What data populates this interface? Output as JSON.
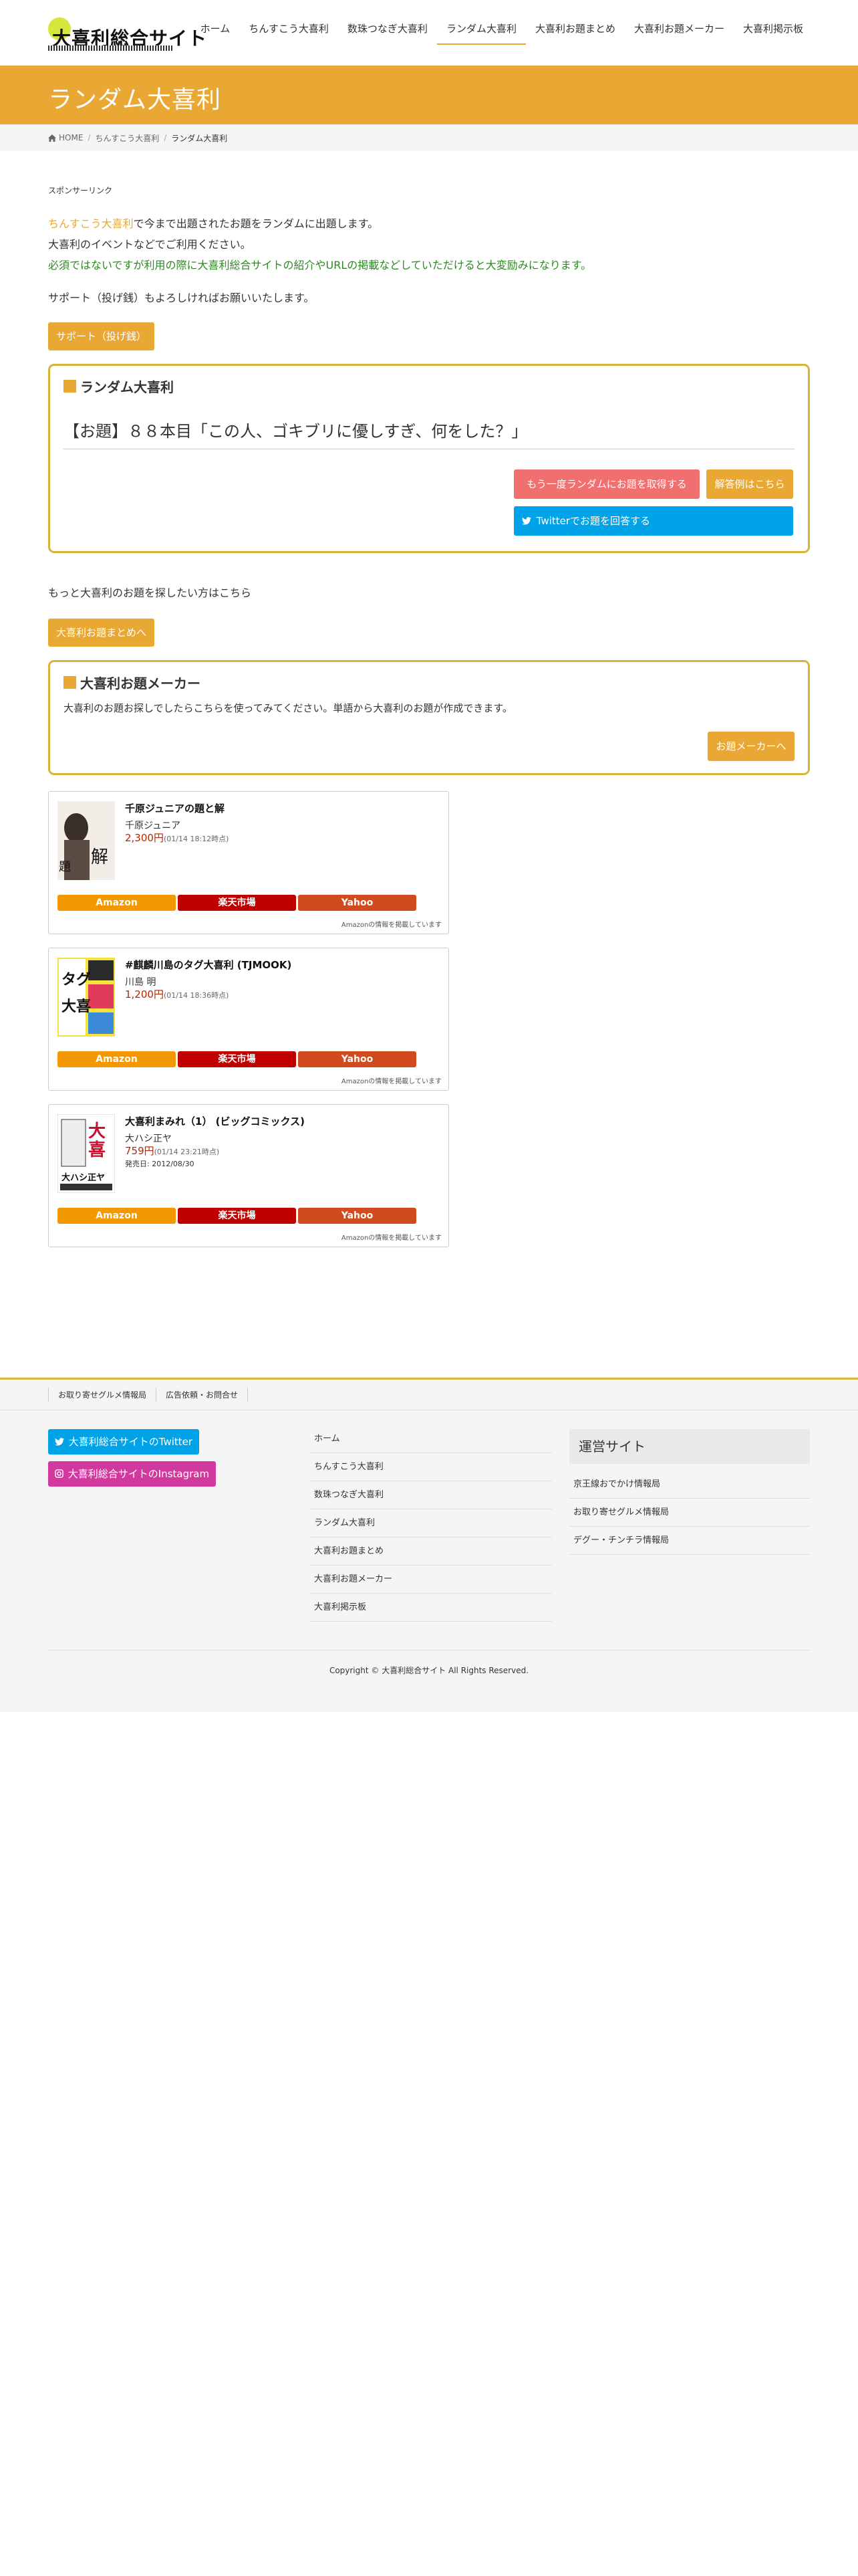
{
  "site": {
    "logo_text": "大喜利総合サイト",
    "nav": [
      "ホーム",
      "ちんすこう大喜利",
      "数珠つなぎ大喜利",
      "ランダム大喜利",
      "大喜利お題まとめ",
      "大喜利お題メーカー",
      "大喜利掲示板"
    ],
    "active_nav": "ランダム大喜利"
  },
  "page": {
    "title": "ランダム大喜利",
    "breadcrumb": {
      "home": "HOME",
      "parent": "ちんすこう大喜利",
      "current": "ランダム大喜利"
    }
  },
  "content": {
    "sponsor": "スポンサーリンク",
    "intro_link": "ちんすこう大喜利",
    "intro_line1_rest": "で今まで出題されたお題をランダムに出題します。",
    "intro_line2": "大喜利のイベントなどでご利用ください。",
    "intro_line3": "必須ではないですが利用の際に大喜利総合サイトの紹介やURLの掲載などしていただけると大変励みになります。",
    "support_text": "サポート（投げ銭）もよろしければお願いいたします。",
    "support_button": "サポート（投げ銭）"
  },
  "random_box": {
    "title": "ランダム大喜利",
    "odai": "【お題】８８本目「この人、ゴキブリに優しすぎ、何をした？」",
    "refresh_button": "もう一度ランダムにお題を取得する",
    "answer_button": "解答例はこちら",
    "twitter_button": "Twitterでお題を回答する"
  },
  "more": {
    "text": "もっと大喜利のお題を探したい方はこちら",
    "button": "大喜利お題まとめへ"
  },
  "maker_box": {
    "title": "大喜利お題メーカー",
    "desc": "大喜利のお題お探しでしたらこちらを使ってみてください。単語から大喜利のお題が作成できます。",
    "button": "お題メーカーへ"
  },
  "products": [
    {
      "title": "千原ジュニアの題と解",
      "author": "千原ジュニア",
      "price": "2,300円",
      "time": "(01/14 18:12時点)",
      "release": ""
    },
    {
      "title": "#麒麟川島のタグ大喜利 (TJMOOK)",
      "author": "川島 明",
      "price": "1,200円",
      "time": "(01/14 18:36時点)",
      "release": ""
    },
    {
      "title": "大喜利まみれ（1） (ビッグコミックス)",
      "author": "大ハシ正ヤ",
      "price": "759円",
      "time": "(01/14 23:21時点)",
      "release": "発売日: 2012/08/30"
    }
  ],
  "product_buttons": {
    "amazon": "Amazon",
    "rakuten": "楽天市場",
    "yahoo": "Yahoo"
  },
  "product_note": "Amazonの情報を掲載しています",
  "footer": {
    "links": [
      "お取り寄せグルメ情報局",
      "広告依頼・お問合せ"
    ],
    "twitter": "大喜利総合サイトのTwitter",
    "instagram": "大喜利総合サイトのInstagram",
    "nav": [
      "ホーム",
      "ちんすこう大喜利",
      "数珠つなぎ大喜利",
      "ランダム大喜利",
      "大喜利お題まとめ",
      "大喜利お題メーカー",
      "大喜利掲示板"
    ],
    "ops_title": "運営サイト",
    "ops": [
      "京王線おでかけ情報局",
      "お取り寄せグルメ情報局",
      "デグー・チンチラ情報局"
    ],
    "copyright": "Copyright © 大喜利総合サイト All Rights Reserved."
  },
  "colors": {
    "accent": "#e9a833",
    "border": "#d7b43a",
    "twitter": "#00a3e7",
    "instagram": "#d2399f",
    "red_button": "#f26f6f"
  }
}
